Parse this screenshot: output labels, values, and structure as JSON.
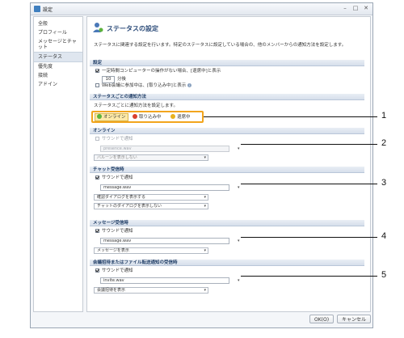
{
  "window": {
    "title": "設定",
    "minimize": "–",
    "maximize": "□",
    "close": "✕"
  },
  "sidebar": {
    "items": [
      {
        "label": "全般"
      },
      {
        "label": "プロフィール"
      },
      {
        "label": "メッセージとチャット"
      },
      {
        "label": "ステータス"
      },
      {
        "label": "優先度"
      },
      {
        "label": "接続"
      },
      {
        "label": "アドイン"
      }
    ]
  },
  "main": {
    "title": "ステータスの設定",
    "description": "ステータスに関連する設定を行います。特定のステータスに設定している場合の、他のメンバーからの通知方法を設定します。",
    "settings": {
      "header": "設定",
      "idle_label": "一定時間コンピューターの操作がない場合、[退席中]と表示",
      "idle_minutes": "10",
      "minutes_unit": "分後",
      "web_meeting_label": "Web会議に参加中は、[取り込み中]と表示"
    },
    "per_status": {
      "header": "ステータスごとの通知方法",
      "description": "ステータスごとに通知方法を設定します。",
      "tabs": [
        {
          "label": "オンライン",
          "color": "#5db33c"
        },
        {
          "label": "取り込み中",
          "color": "#d9402f"
        },
        {
          "label": "退席中",
          "color": "#e8b21f"
        }
      ]
    },
    "online": {
      "header": "オンライン",
      "sound_label": "サウンドで通知",
      "sound_file": "presence.wav",
      "balloon": "バルーンを表示しない"
    },
    "chat": {
      "header": "チャット受信時",
      "sound_label": "サウンドで通知",
      "sound_file": "message.wav",
      "dialog": "確認ダイアログを表示する",
      "chat_dialog": "チャットのダイアログを表示しない"
    },
    "message": {
      "header": "メッセージ受信時",
      "sound_label": "サウンドで通知",
      "sound_file": "message.wav",
      "display": "メッセージを表示"
    },
    "meeting": {
      "header": "会議招待またはファイル転送通知の受信時",
      "sound_label": "サウンドで通知",
      "sound_file": "invite.wav",
      "display": "会議招待を表示"
    }
  },
  "footer": {
    "ok": "OK(O)",
    "cancel": "キャンセル"
  },
  "callouts": [
    "1",
    "2",
    "3",
    "4",
    "5"
  ]
}
